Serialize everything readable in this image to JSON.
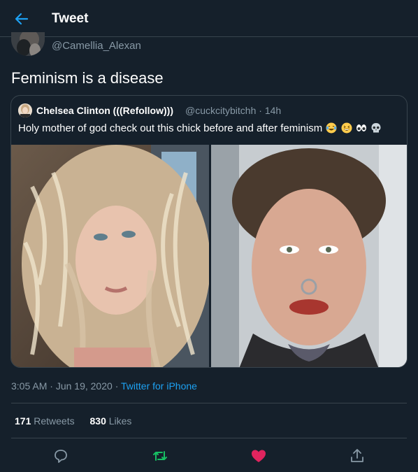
{
  "header": {
    "title": "Tweet",
    "back_icon": "arrow-left-icon"
  },
  "author": {
    "handle": "@Camellia_Alexan"
  },
  "tweet": {
    "text": "Feminism is a disease"
  },
  "quote": {
    "name": "Chelsea Clinton (((Refollow)))",
    "handle": "@cuckcitybitchh",
    "separator": "·",
    "time": "14h",
    "text": "Holy mother of god check out this chick before and after feminism",
    "emojis": [
      "face-with-tears-of-joy",
      "grinning-squinting-face",
      "eyes",
      "skull"
    ]
  },
  "meta": {
    "time": "3:05 AM",
    "sep1": "·",
    "date": "Jun 19, 2020",
    "sep2": "·",
    "source": "Twitter for iPhone"
  },
  "stats": {
    "retweets_count": "171",
    "retweets_label": "Retweets",
    "likes_count": "830",
    "likes_label": "Likes"
  },
  "actions": [
    "reply-icon",
    "retweet-icon",
    "like-icon",
    "share-icon"
  ],
  "colors": {
    "background": "#15202b",
    "border": "#38444d",
    "secondary_text": "#8899a6",
    "link": "#1da1f2",
    "retweet": "#17bf63",
    "like": "#e0245e"
  }
}
